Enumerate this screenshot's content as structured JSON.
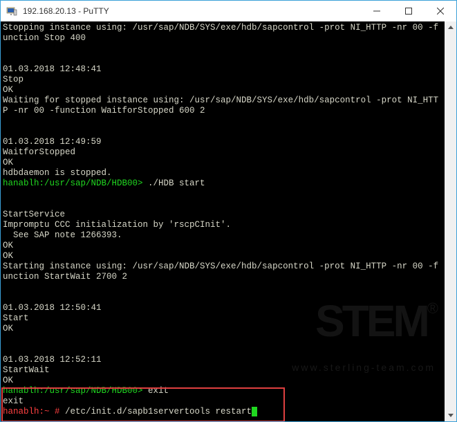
{
  "window": {
    "title": "192.168.20.13 - PuTTY"
  },
  "terminal": {
    "lines": [
      {
        "text": "Stopping instance using: /usr/sap/NDB/SYS/exe/hdb/sapcontrol -prot NI_HTTP -nr 00 -function Stop 400"
      },
      {
        "text": ""
      },
      {
        "text": ""
      },
      {
        "text": "01.03.2018 12:48:41"
      },
      {
        "text": "Stop"
      },
      {
        "text": "OK"
      },
      {
        "text": "Waiting for stopped instance using: /usr/sap/NDB/SYS/exe/hdb/sapcontrol -prot NI_HTTP -nr 00 -function WaitforStopped 600 2"
      },
      {
        "text": ""
      },
      {
        "text": ""
      },
      {
        "text": "01.03.2018 12:49:59"
      },
      {
        "text": "WaitforStopped"
      },
      {
        "text": "OK"
      },
      {
        "text": "hdbdaemon is stopped."
      },
      {
        "prompt": "hanablh:/usr/sap/NDB/HDB00> ",
        "promptClass": "prompt-green",
        "cmd": "./HDB start"
      },
      {
        "text": ""
      },
      {
        "text": ""
      },
      {
        "text": "StartService"
      },
      {
        "text": "Impromptu CCC initialization by 'rscpCInit'."
      },
      {
        "text": "  See SAP note 1266393."
      },
      {
        "text": "OK"
      },
      {
        "text": "OK"
      },
      {
        "text": "Starting instance using: /usr/sap/NDB/SYS/exe/hdb/sapcontrol -prot NI_HTTP -nr 00 -function StartWait 2700 2"
      },
      {
        "text": ""
      },
      {
        "text": ""
      },
      {
        "text": "01.03.2018 12:50:41"
      },
      {
        "text": "Start"
      },
      {
        "text": "OK"
      },
      {
        "text": ""
      },
      {
        "text": ""
      },
      {
        "text": "01.03.2018 12:52:11"
      },
      {
        "text": "StartWait"
      },
      {
        "text": "OK"
      },
      {
        "prompt": "hanablh:/usr/sap/NDB/HDB00> ",
        "promptClass": "prompt-green",
        "cmd": "exit"
      },
      {
        "text": "exit"
      },
      {
        "prompt": "hanablh:~ # ",
        "promptClass": "prompt-red",
        "cmd": "/etc/init.d/sapb1servertools restart",
        "cursor": true
      }
    ]
  },
  "watermark": {
    "logo": "STEM",
    "url": "www.sterling-team.com"
  }
}
